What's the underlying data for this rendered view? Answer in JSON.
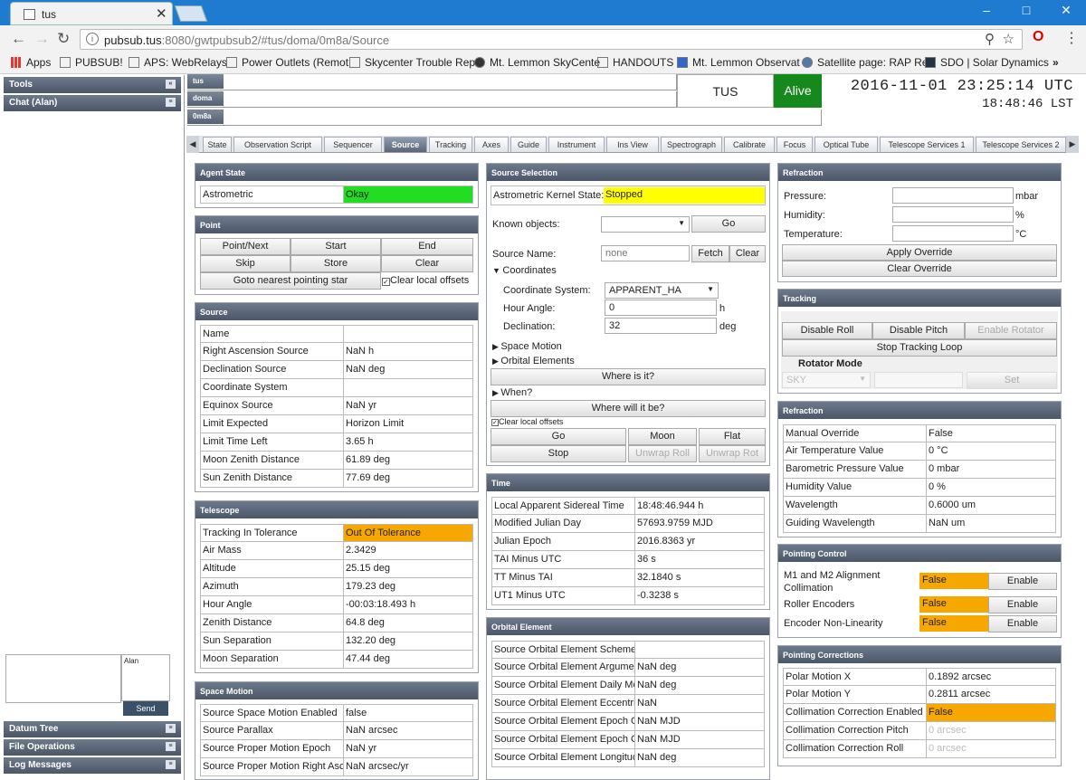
{
  "browser": {
    "tab_title": "tus",
    "url_host": "pubsub.tus",
    "url_rest": ":8080/gwtpubsub2/#tus/doma/0m8a/Source",
    "bookmarks": [
      "Apps",
      "PUBSUB!",
      "APS: WebRelays",
      "Power Outlets (Remot",
      "Skycenter Trouble Rep",
      "Mt. Lemmon SkyCente",
      "HANDOUTS",
      "Mt. Lemmon Observat",
      "Satellite page: RAP Re",
      "SDO | Solar Dynamics"
    ]
  },
  "sidebar": {
    "tools": "Tools",
    "chat": "Chat (Alan)",
    "chat_user": "Alan",
    "send": "Send",
    "datum_tree": "Datum Tree",
    "file_ops": "File Operations",
    "log_messages": "Log Messages"
  },
  "header": {
    "crumbs": [
      "tus",
      "doma",
      "0m8a"
    ],
    "system": "TUS",
    "status": "Alive",
    "utc": "2016-11-01 23:25:14 UTC",
    "lst": "18:48:46 LST",
    "status_color": "#16891d"
  },
  "tabs": [
    "State",
    "Observation Script",
    "Sequencer",
    "Source",
    "Tracking",
    "Axes",
    "Guide",
    "Instrument",
    "Ins View",
    "Spectrograph",
    "Calibrate",
    "Focus",
    "Optical Tube",
    "Telescope Services 1",
    "Telescope Services 2"
  ],
  "agent_state": {
    "title": "Agent State",
    "label": "Astrometric",
    "value": "Okay"
  },
  "point": {
    "title": "Point",
    "buttons": [
      "Point/Next",
      "Start",
      "End",
      "Skip",
      "Store",
      "Clear"
    ],
    "goto": "Goto nearest pointing star",
    "clear_offsets": "Clear local offsets"
  },
  "source": {
    "title": "Source",
    "rows": [
      [
        "Name",
        ""
      ],
      [
        "Right Ascension Source",
        "NaN h"
      ],
      [
        "Declination Source",
        "NaN deg"
      ],
      [
        "Coordinate System",
        ""
      ],
      [
        "Equinox Source",
        "NaN yr"
      ],
      [
        "Limit Expected",
        "Horizon Limit"
      ],
      [
        "Limit Time Left",
        "3.65 h"
      ],
      [
        "Moon Zenith Distance",
        "61.89 deg"
      ],
      [
        "Sun Zenith Distance",
        "77.69 deg"
      ]
    ]
  },
  "telescope": {
    "title": "Telescope",
    "rows": [
      [
        "Tracking In Tolerance",
        "Out Of Tolerance"
      ],
      [
        "Air Mass",
        "2.3429"
      ],
      [
        "Altitude",
        "25.15 deg"
      ],
      [
        "Azimuth",
        "179.23 deg"
      ],
      [
        "Hour Angle",
        "-00:03:18.493 h"
      ],
      [
        "Zenith Distance",
        "64.8 deg"
      ],
      [
        "Sun Separation",
        "132.20 deg"
      ],
      [
        "Moon Separation",
        "47.44 deg"
      ]
    ]
  },
  "space_motion": {
    "title": "Space Motion",
    "rows": [
      [
        "Source Space Motion Enabled",
        "false"
      ],
      [
        "Source Parallax",
        "NaN arcsec"
      ],
      [
        "Source Proper Motion Epoch",
        "NaN yr"
      ],
      [
        "Source Proper Motion Right Asc",
        "NaN arcsec/yr"
      ]
    ]
  },
  "source_selection": {
    "title": "Source Selection",
    "kernel_label": "Astrometric Kernel State:",
    "kernel_value": "Stopped",
    "known_label": "Known objects:",
    "go": "Go",
    "name_label": "Source Name:",
    "name_placeholder": "none",
    "fetch": "Fetch",
    "clear": "Clear",
    "coordinates": "Coordinates",
    "coord_sys_label": "Coordinate System:",
    "coord_sys_value": "APPARENT_HA",
    "ha_label": "Hour Angle:",
    "ha_value": "0",
    "ha_unit": "h",
    "dec_label": "Declination:",
    "dec_value": "32",
    "dec_unit": "deg",
    "space_motion": "Space Motion",
    "orbital": "Orbital Elements",
    "where_is": "Where is it?",
    "when": "When?",
    "where_will": "Where will it be?",
    "clear_offsets": "Clear local offsets",
    "b_go": "Go",
    "b_moon": "Moon",
    "b_flat": "Flat",
    "b_stop": "Stop",
    "b_unwrap_roll": "Unwrap Roll",
    "b_unwrap_rot": "Unwrap Rot"
  },
  "time": {
    "title": "Time",
    "rows": [
      [
        "Local Apparent Sidereal Time",
        "18:48:46.944 h"
      ],
      [
        "Modified Julian Day",
        "57693.9759 MJD"
      ],
      [
        "Julian Epoch",
        "2016.8363 yr"
      ],
      [
        "TAI Minus UTC",
        "36 s"
      ],
      [
        "TT Minus TAI",
        "32.1840 s"
      ],
      [
        "UT1 Minus UTC",
        "-0.3238 s"
      ]
    ]
  },
  "orbital_element": {
    "title": "Orbital Element",
    "rows": [
      [
        "Source Orbital Element Scheme",
        ""
      ],
      [
        "Source Orbital Element Argumen",
        "NaN deg"
      ],
      [
        "Source Orbital Element Daily Mo",
        "NaN deg"
      ],
      [
        "Source Orbital Element Eccentric",
        "NaN"
      ],
      [
        "Source Orbital Element Epoch O",
        "NaN MJD"
      ],
      [
        "Source Orbital Element Epoch O",
        "NaN MJD"
      ],
      [
        "Source Orbital Element Longitud",
        "NaN deg"
      ]
    ]
  },
  "refraction_override": {
    "title": "Refraction",
    "pressure": "Pressure:",
    "pressure_unit": "mbar",
    "humidity": "Humidity:",
    "humidity_unit": "%",
    "temperature": "Temperature:",
    "temperature_unit": "°C",
    "apply": "Apply Override",
    "clear": "Clear Override"
  },
  "tracking": {
    "title": "Tracking",
    "disable_roll": "Disable Roll",
    "disable_pitch": "Disable Pitch",
    "enable_rotator": "Enable Rotator",
    "stop": "Stop Tracking Loop",
    "rotator_mode": "Rotator Mode",
    "mode_value": "SKY",
    "set": "Set"
  },
  "refraction": {
    "title": "Refraction",
    "rows": [
      [
        "Manual Override",
        "False"
      ],
      [
        "Air Temperature Value",
        "0 °C"
      ],
      [
        "Barometric Pressure Value",
        "0 mbar"
      ],
      [
        "Humidity Value",
        "0 %"
      ],
      [
        "Wavelength",
        "0.6000 um"
      ],
      [
        "Guiding Wavelength",
        "NaN um"
      ]
    ]
  },
  "pointing_control": {
    "title": "Pointing Control",
    "rows": [
      [
        "M1 and M2 Alignment",
        "Collimation",
        "False",
        "Enable"
      ],
      [
        "Roller Encoders",
        "",
        "False",
        "Enable"
      ],
      [
        "Encoder Non-Linearity",
        "",
        "False",
        "Enable"
      ]
    ]
  },
  "pointing_corrections": {
    "title": "Pointing Corrections",
    "rows": [
      [
        "Polar Motion X",
        "0.1892 arcsec"
      ],
      [
        "Polar Motion Y",
        "0.2811 arcsec"
      ],
      [
        "Collimation Correction Enabled",
        "False"
      ],
      [
        "Collimation Correction Pitch",
        "0 arcsec"
      ],
      [
        "Collimation Correction Roll",
        "0 arcsec"
      ]
    ]
  },
  "colors": {
    "okay": "#22dd22",
    "stopped": "#ffff00",
    "warn": "#f7a800"
  }
}
